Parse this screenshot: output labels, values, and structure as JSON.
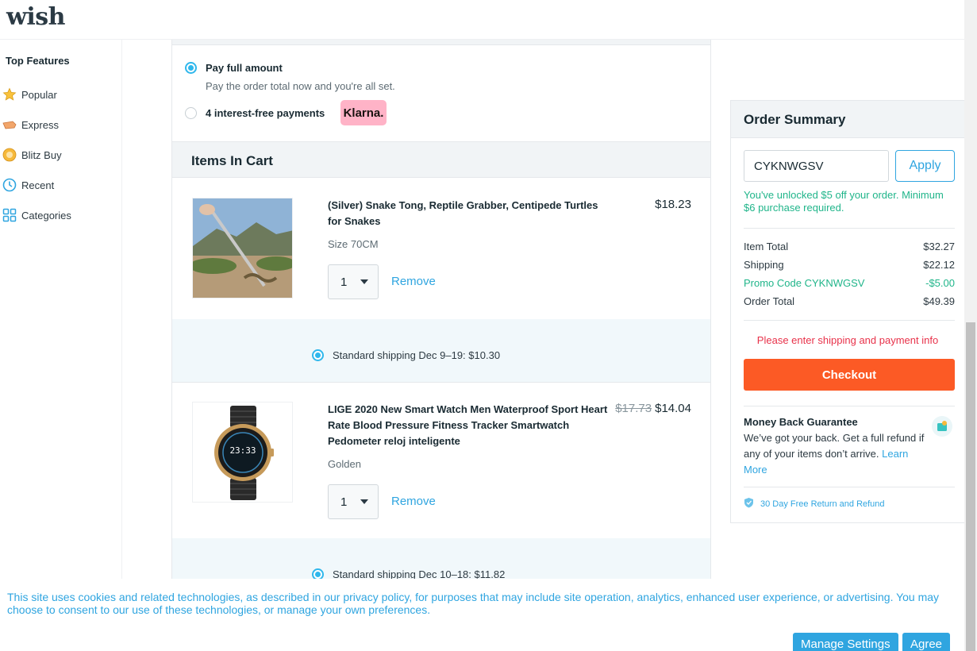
{
  "header": {
    "logo_text": "wish"
  },
  "sidebar": {
    "title": "Top Features",
    "items": [
      {
        "label": "Popular",
        "icon": "star-icon"
      },
      {
        "label": "Express",
        "icon": "express-truck-icon"
      },
      {
        "label": "Blitz Buy",
        "icon": "blitz-buy-icon"
      },
      {
        "label": "Recent",
        "icon": "clock-icon"
      },
      {
        "label": "Categories",
        "icon": "grid-icon"
      }
    ]
  },
  "payment": {
    "full_label": "Pay full amount",
    "full_sub": "Pay the order total now and you're all set.",
    "installments_label": "4 interest-free payments",
    "klarna_text": "Klarna."
  },
  "cart": {
    "heading": "Items In Cart",
    "items": [
      {
        "title": "(Silver) Snake Tong, Reptile Grabber, Centipede Turtles for Snakes",
        "variant": "Size 70CM",
        "price": "$18.23",
        "original_price": "",
        "qty": "1",
        "remove_label": "Remove",
        "shipping": "Standard shipping Dec 9–19: $10.30"
      },
      {
        "title": "LIGE 2020 New Smart Watch Men Waterproof Sport Heart Rate Blood Pressure Fitness Tracker Smartwatch Pedometer reloj inteligente",
        "variant": "Golden",
        "price": "$14.04",
        "original_price": "$17.73",
        "qty": "1",
        "remove_label": "Remove",
        "shipping": "Standard shipping Dec 10–18: $11.82",
        "watch_time": "23:33"
      }
    ]
  },
  "summary": {
    "heading": "Order Summary",
    "promo_value": "CYKNWGSV",
    "apply_label": "Apply",
    "promo_msg": "You've unlocked $5 off your order. Minimum $6 purchase required.",
    "rows": [
      {
        "label": "Item Total",
        "value": "$32.27"
      },
      {
        "label": "Shipping",
        "value": "$22.12"
      },
      {
        "label": "Promo Code CYKNWGSV",
        "value": "-$5.00"
      },
      {
        "label": "Order Total",
        "value": "$49.39"
      }
    ],
    "warning": "Please enter shipping and payment info",
    "checkout_label": "Checkout",
    "mbg_title": "Money Back Guarantee",
    "mbg_text": "We’ve got your back. Get a full refund if any of your items don’t arrive.",
    "mbg_link": "Learn More",
    "return_text": "30 Day Free Return and Refund"
  },
  "cookie": {
    "text": "This site uses cookies and related technologies, as described in our privacy policy, for purposes that may include site operation, analytics, enhanced user experience, or advertising. You may choose to consent to our use of these technologies, or manage your own preferences.",
    "manage_label": "Manage Settings",
    "agree_label": "Agree"
  },
  "colors": {
    "accent_blue": "#2fa5e0",
    "radio_blue": "#2fb7ec",
    "checkout_orange": "#fc5a25",
    "promo_green": "#20b58a",
    "warning_red": "#e8324a",
    "klarna_pink": "#ffb3c7"
  }
}
